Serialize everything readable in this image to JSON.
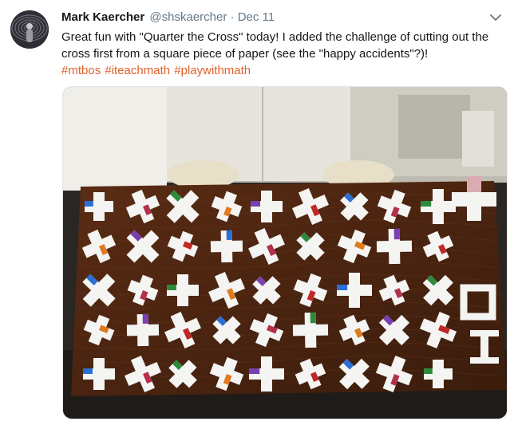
{
  "tweet": {
    "author_name": "Mark Kaercher",
    "handle": "@shskaercher",
    "separator": "·",
    "date": "Dec 11",
    "text": "Great fun with \"Quarter the Cross\" today! I added the challenge of cutting out the cross first from a square piece of paper (see the \"happy accidents\"?)!",
    "hashtags": [
      "#mtbos",
      "#iteachmath",
      "#playwithmath"
    ],
    "menu_icon": "chevron-down-icon"
  },
  "colors": {
    "hashtag": "#e0602b",
    "secondary_text": "#657786",
    "primary_text": "#14171a"
  }
}
